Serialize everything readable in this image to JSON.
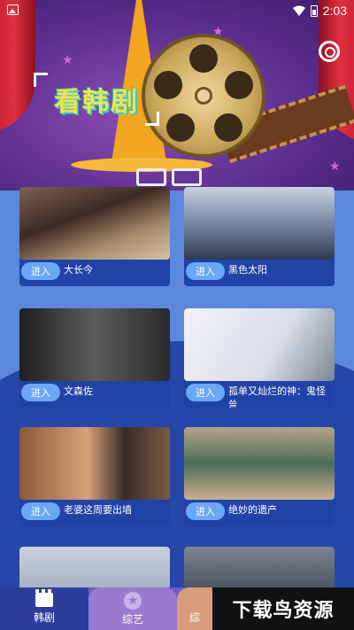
{
  "status_bar": {
    "time": "2:03",
    "icons": [
      "image-icon",
      "wifi-icon",
      "battery-icon"
    ]
  },
  "header": {
    "title": "看韩剧",
    "settings_icon": "gear-icon"
  },
  "cards": [
    {
      "enter_label": "进入",
      "name": "大长今"
    },
    {
      "enter_label": "进入",
      "name": "黑色太阳"
    },
    {
      "enter_label": "进入",
      "name": "文森佐"
    },
    {
      "enter_label": "进入",
      "name": "孤单又灿烂的神：鬼怪 쓸\n란하神 - 도깨비"
    },
    {
      "enter_label": "进入",
      "name": "老婆这周要出墙"
    },
    {
      "enter_label": "进入",
      "name": "绝妙的遗产"
    },
    {
      "enter_label": "",
      "name": ""
    },
    {
      "enter_label": "",
      "name": ""
    }
  ],
  "tabs": [
    {
      "label": "韩剧",
      "icon": "clapperboard-icon",
      "selected": true
    },
    {
      "label": "综艺",
      "icon": "star-icon",
      "selected": false
    },
    {
      "label": "综",
      "icon": "",
      "selected": false
    }
  ],
  "watermark": "下载鸟资源",
  "colors": {
    "banner_purple": "#5c2f8f",
    "content_blue": "#5b88dc",
    "card_navy": "#2142a6",
    "enter_button": "#6aa8f5",
    "title_yellow": "#ffe04a"
  }
}
